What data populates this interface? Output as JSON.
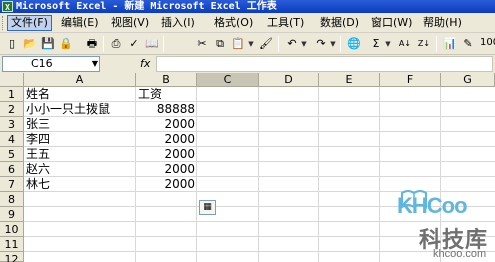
{
  "window": {
    "title": "Microsoft Excel - 新建 Microsoft Excel 工作表",
    "app_icon_glyph": "X"
  },
  "menubar": {
    "items": [
      {
        "label": "文件(F)",
        "active": true
      },
      {
        "label": "编辑(E)"
      },
      {
        "label": "视图(V)"
      },
      {
        "label": "插入(I)"
      },
      {
        "label": "格式(O)"
      },
      {
        "label": "工具(T)"
      },
      {
        "label": "数据(D)"
      },
      {
        "label": "窗口(W)"
      },
      {
        "label": "帮助(H)"
      }
    ]
  },
  "toolbar": {
    "buttons": [
      {
        "name": "new-icon",
        "glyph": "▯"
      },
      {
        "name": "open-folder-icon",
        "glyph": "📂"
      },
      {
        "name": "save-icon",
        "glyph": "💾"
      },
      {
        "name": "permission-icon",
        "glyph": "🔒"
      },
      {
        "name": "print-preview-icon",
        "glyph": "🖶"
      },
      {
        "name": "print-icon",
        "glyph": "⎙"
      },
      {
        "name": "spelling-icon",
        "glyph": "✓"
      },
      {
        "name": "research-icon",
        "glyph": "📖"
      },
      {
        "name": "cut-icon",
        "glyph": "✂"
      },
      {
        "name": "copy-icon",
        "glyph": "⧉"
      },
      {
        "name": "paste-icon",
        "glyph": "📋"
      },
      {
        "name": "format-painter-icon",
        "glyph": "🖌"
      },
      {
        "name": "undo-icon",
        "glyph": "↶"
      },
      {
        "name": "redo-icon",
        "glyph": "↷"
      },
      {
        "name": "hyperlink-icon",
        "glyph": "🌐"
      },
      {
        "name": "autosum-icon",
        "glyph": "Σ"
      },
      {
        "name": "sort-ascending-icon",
        "glyph": "A↓"
      },
      {
        "name": "sort-descending-icon",
        "glyph": "Z↓"
      },
      {
        "name": "chart-wizard-icon",
        "glyph": "📊"
      },
      {
        "name": "drawing-icon",
        "glyph": "✎"
      }
    ],
    "zoom": "100"
  },
  "formulabar": {
    "namebox": "C16",
    "fx": "fx",
    "formula": ""
  },
  "columns": [
    "A",
    "B",
    "C",
    "D",
    "E",
    "F",
    "G"
  ],
  "rows": [
    "1",
    "2",
    "3",
    "4",
    "5",
    "6",
    "7",
    "8",
    "9",
    "10",
    "11",
    "12"
  ],
  "sheet": {
    "header": {
      "name": "姓名",
      "salary": "工资"
    },
    "records": [
      {
        "name": "小小一只土拨鼠",
        "salary": "88888"
      },
      {
        "name": "张三",
        "salary": "2000"
      },
      {
        "name": "李四",
        "salary": "2000"
      },
      {
        "name": "王五",
        "salary": "2000"
      },
      {
        "name": "赵六",
        "salary": "2000"
      },
      {
        "name": "林七",
        "salary": "2000"
      }
    ]
  },
  "watermark": {
    "logo": "KHCoo",
    "cn": "科技库",
    "domain": "khcoo.com"
  },
  "colors": {
    "titlebar": "#0a3cbf",
    "chrome": "#ece9d8",
    "selected_header": "#c9c5b5",
    "watermark_blue": "#5fb7e0"
  }
}
